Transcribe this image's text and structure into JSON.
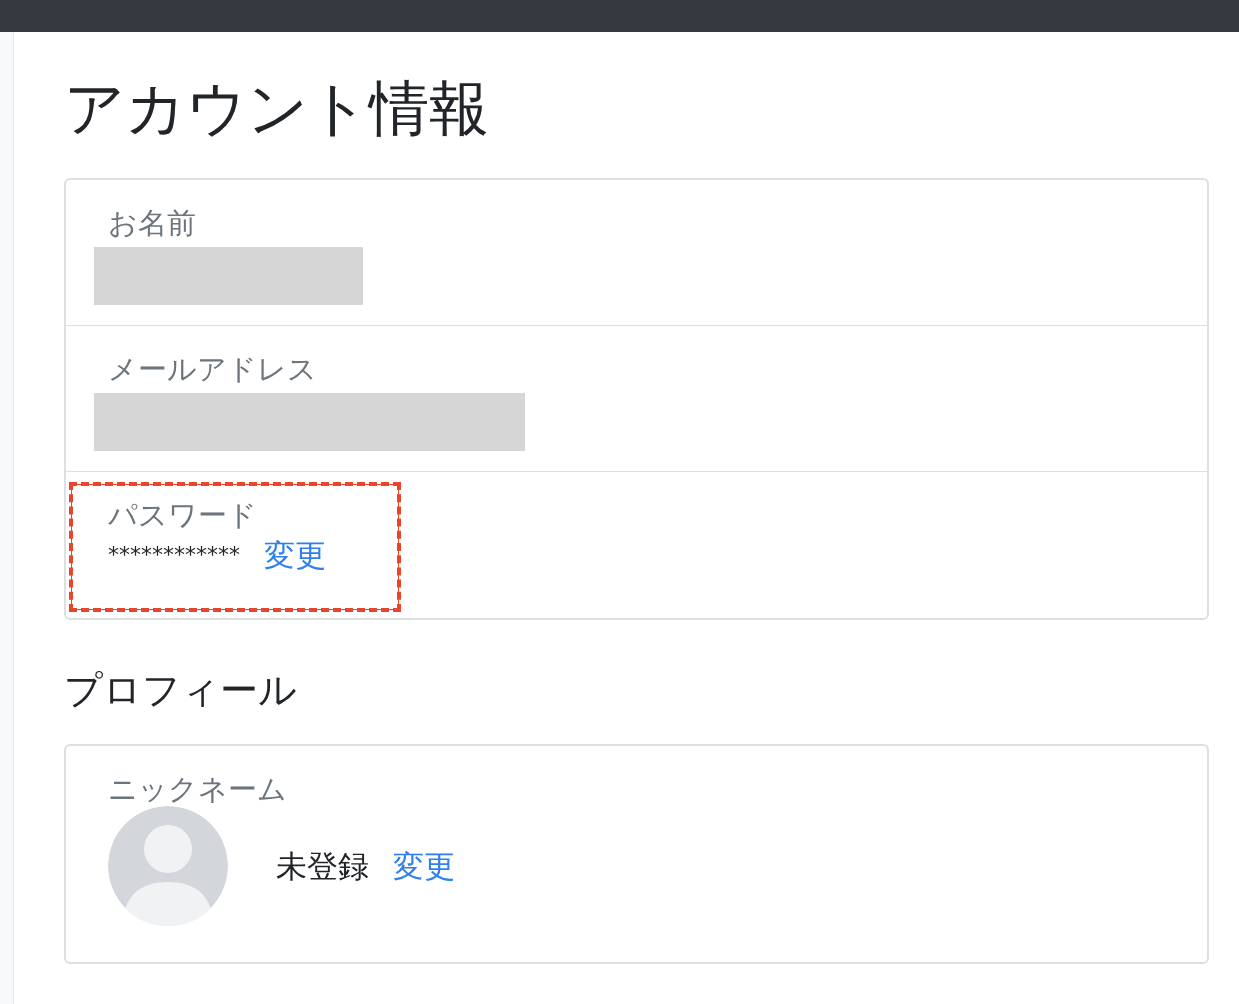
{
  "page": {
    "title": "アカウント情報"
  },
  "account": {
    "fields": [
      {
        "kind": "name",
        "label": "お名前",
        "redacted": true
      },
      {
        "kind": "email",
        "label": "メールアドレス",
        "redacted": true
      },
      {
        "kind": "password",
        "label": "パスワード",
        "value": "************",
        "action": "変更",
        "highlighted": true
      }
    ]
  },
  "profile": {
    "title": "プロフィール",
    "nickname": {
      "label": "ニックネーム",
      "value": "未登録",
      "action": "変更"
    }
  }
}
